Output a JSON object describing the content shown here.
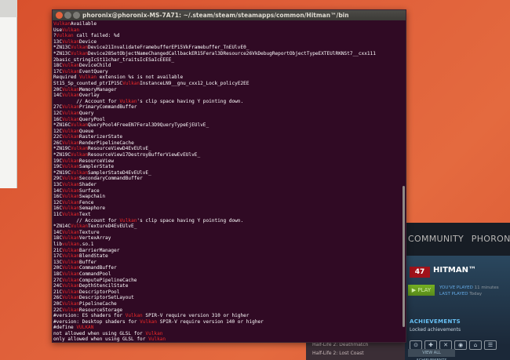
{
  "terminal": {
    "title": "phoronix@phoronix-MS-7A71: ~/.steam/steam/steamapps/common/Hitman™/bin",
    "prompt_user": "phoronix@phoronix-MS-7A71",
    "prompt_path": ":~/.steam/steam/steamapps/common/Hitman™/bin$",
    "lines": [
      {
        "pre": "",
        "hl": "Vulkan",
        "post": "Available"
      },
      {
        "pre": "Use",
        "hl": "Vulkan",
        "post": ""
      },
      {
        "pre": "?",
        "hl": "Vulkan",
        "post": " call failed: %d"
      },
      {
        "pre": "13C",
        "hl": "Vulkan",
        "post": "Device"
      },
      {
        "pre": "*ZN13C",
        "hl": "Vulkan",
        "post": "Device21InvalidateFramebufferEP15VkFramebuffer_TnEUlvE0_"
      },
      {
        "pre": "*ZN13C",
        "hl": "Vulkan",
        "post": "Device28SetObjectNameChangedCallbackER15Feral3DResource26VkDebugReportObjectTypeEXTEUlRKNSt7__cxx111"
      },
      {
        "pre": "2basic_stringIcSt11char_traitsIcESaIcEEEE_",
        "hl": "",
        "post": ""
      },
      {
        "pre": "18C",
        "hl": "Vulkan",
        "post": "DeviceChild"
      },
      {
        "pre": "17C",
        "hl": "Vulkan",
        "post": "EventQuery"
      },
      {
        "pre": "Required ",
        "hl": "Vulkan",
        "post": " extension %s is not available"
      },
      {
        "pre": "St15_Sp_counted_ptrIP15C",
        "hl": "Vulkan",
        "post": "InstanceLN9__gnu_cxx12_Lock_policyE2EE"
      },
      {
        "pre": "20C",
        "hl": "Vulkan",
        "post": "MemoryManager"
      },
      {
        "pre": "14C",
        "hl": "Vulkan",
        "post": "Overlay"
      },
      {
        "pre": "        // Account for ",
        "hl": "Vulkan",
        "post": "'s clip space having Y pointing down."
      },
      {
        "pre": "27C",
        "hl": "Vulkan",
        "post": "PrimaryCommandBuffer"
      },
      {
        "pre": "12C",
        "hl": "Vulkan",
        "post": "Query"
      },
      {
        "pre": "16C",
        "hl": "Vulkan",
        "post": "QueryPool"
      },
      {
        "pre": "*ZN16C",
        "hl": "Vulkan",
        "post": "QueryPool4FreeEN7Feral3D9QueryTypeEjEUlvE_"
      },
      {
        "pre": "12C",
        "hl": "Vulkan",
        "post": "Queue"
      },
      {
        "pre": "22C",
        "hl": "Vulkan",
        "post": "RasterizerState"
      },
      {
        "pre": "26C",
        "hl": "Vulkan",
        "post": "RenderPipelineCache"
      },
      {
        "pre": "*ZN19C",
        "hl": "Vulkan",
        "post": "ResourceViewD4EvEUlvE_"
      },
      {
        "pre": "*ZN19C",
        "hl": "Vulkan",
        "post": "ResourceView17DestroyBufferViewEvEUlvE_"
      },
      {
        "pre": "19C",
        "hl": "Vulkan",
        "post": "ResourceView"
      },
      {
        "pre": "19C",
        "hl": "Vulkan",
        "post": "SamplerState"
      },
      {
        "pre": "*ZN19C",
        "hl": "Vulkan",
        "post": "SamplerStateD4EvEUlvE_"
      },
      {
        "pre": "29C",
        "hl": "Vulkan",
        "post": "SecondaryCommandBuffer"
      },
      {
        "pre": "13C",
        "hl": "Vulkan",
        "post": "Shader"
      },
      {
        "pre": "14C",
        "hl": "Vulkan",
        "post": "Surface"
      },
      {
        "pre": "16C",
        "hl": "Vulkan",
        "post": "Swapchain"
      },
      {
        "pre": "12C",
        "hl": "Vulkan",
        "post": "Fence"
      },
      {
        "pre": "16C",
        "hl": "Vulkan",
        "post": "Semaphore"
      },
      {
        "pre": "11C",
        "hl": "Vulkan",
        "post": "Text"
      },
      {
        "pre": "        // Account for ",
        "hl": "Vulkan",
        "post": "'s clip space having Y pointing down."
      },
      {
        "pre": "*ZN14C",
        "hl": "Vulkan",
        "post": "TextureD4EvEUlvE_"
      },
      {
        "pre": "14C",
        "hl": "Vulkan",
        "post": "Texture"
      },
      {
        "pre": "18C",
        "hl": "Vulkan",
        "post": "VertexArray"
      },
      {
        "pre": "lib",
        "hl": "vulkan",
        "post": ".so.1"
      },
      {
        "pre": "21C",
        "hl": "Vulkan",
        "post": "BarrierManager"
      },
      {
        "pre": "17C",
        "hl": "Vulkan",
        "post": "BlendState"
      },
      {
        "pre": "13C",
        "hl": "Vulkan",
        "post": "Buffer"
      },
      {
        "pre": "20C",
        "hl": "Vulkan",
        "post": "CommandBuffer"
      },
      {
        "pre": "18C",
        "hl": "Vulkan",
        "post": "CommandPool"
      },
      {
        "pre": "27C",
        "hl": "Vulkan",
        "post": "ComputePipelineCache"
      },
      {
        "pre": "24C",
        "hl": "Vulkan",
        "post": "DepthStencilState"
      },
      {
        "pre": "21C",
        "hl": "Vulkan",
        "post": "DescriptorPool"
      },
      {
        "pre": "26C",
        "hl": "Vulkan",
        "post": "DescriptorSetLayout"
      },
      {
        "pre": "20C",
        "hl": "Vulkan",
        "post": "PipelineCache"
      },
      {
        "pre": "22C",
        "hl": "Vulkan",
        "post": "ResourceStorage"
      },
      {
        "pre": "#version: ES shaders for ",
        "hl": "Vulkan",
        "post": " SPIR-V require version 310 or higher"
      },
      {
        "pre": "#version: Desktop shaders for ",
        "hl": "Vulkan",
        "post": " SPIR-V require version 140 or higher"
      },
      {
        "pre": "#define ",
        "hl": "VULKAN",
        "post": ""
      },
      {
        "pre": "not allowed when using GLSL for ",
        "hl": "Vulkan",
        "post": ""
      },
      {
        "pre": "only allowed when using GLSL for ",
        "hl": "Vulkan",
        "post": ""
      }
    ]
  },
  "steam": {
    "nav": [
      "COMMUNITY",
      "PHORONIX"
    ],
    "game_badge": "47",
    "game_title": "HITMAN™",
    "play_label": "PLAY",
    "played_label": "YOU'VE PLAYED",
    "played_value": "11 minutes",
    "last_played_label": "LAST PLAYED",
    "last_played_value": "Today",
    "achievements_heading": "ACHIEVEMENTS",
    "locked_label": "Locked achievements",
    "view_all_label": "VIEW ALL ACHIEVEMENTS"
  },
  "bg_list": [
    "Half-Life 2: Deathmatch",
    "Half-Life 2: Lost Coast"
  ]
}
